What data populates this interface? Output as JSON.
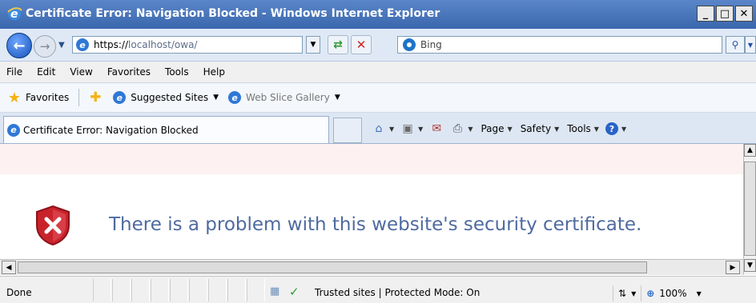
{
  "window": {
    "title": "Certificate Error: Navigation Blocked - Windows Internet Explorer",
    "min_glyph": "_",
    "max_glyph": "□",
    "close_glyph": "✕"
  },
  "nav": {
    "url_protocol": "https://",
    "url_host": "localhost/owa/",
    "search_placeholder": "Bing"
  },
  "menu": {
    "items": [
      "File",
      "Edit",
      "View",
      "Favorites",
      "Tools",
      "Help"
    ]
  },
  "favorites_bar": {
    "favorites_label": "Favorites",
    "links": [
      {
        "label": "Suggested Sites",
        "gray": false
      },
      {
        "label": "Web Slice Gallery",
        "gray": true
      }
    ]
  },
  "tab": {
    "title": "Certificate Error: Navigation Blocked"
  },
  "command_bar": {
    "page_label": "Page",
    "safety_label": "Safety",
    "tools_label": "Tools",
    "help_glyph": "?"
  },
  "content": {
    "heading": "There is a problem with this website's security certificate."
  },
  "status": {
    "text": "Done",
    "zone": "Trusted sites | Protected Mode: On",
    "zoom": "100%"
  }
}
